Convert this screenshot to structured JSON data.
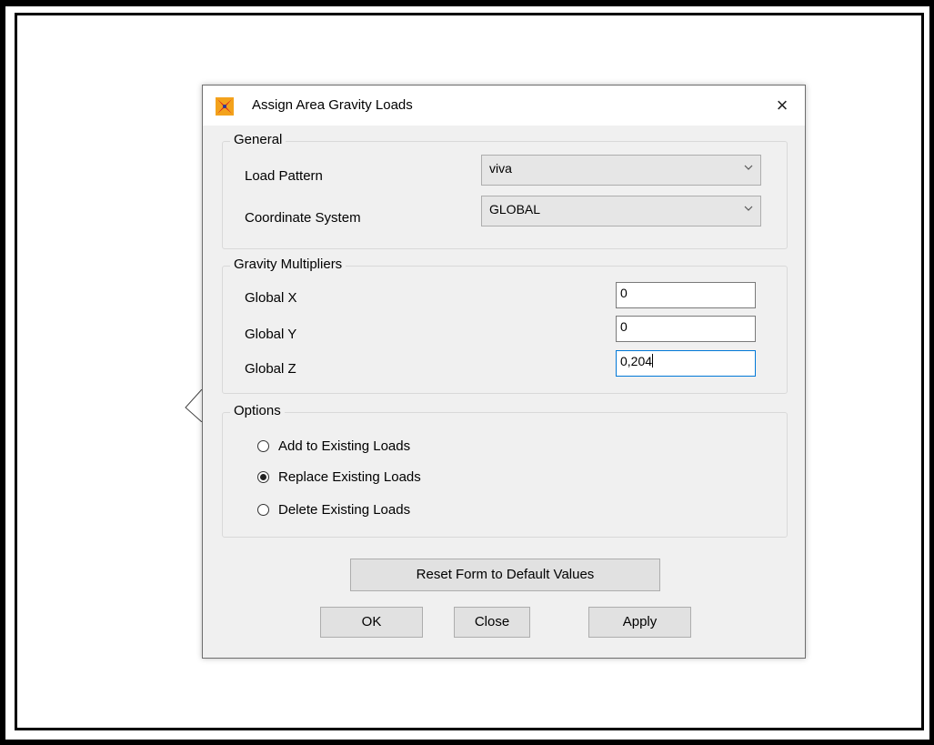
{
  "dialog": {
    "title": "Assign Area Gravity Loads",
    "close_glyph": "×"
  },
  "general": {
    "title": "General",
    "load_pattern_label": "Load Pattern",
    "load_pattern_value": "viva",
    "coord_system_label": "Coordinate System",
    "coord_system_value": "GLOBAL"
  },
  "gravity": {
    "title": "Gravity Multipliers",
    "x_label": "Global X",
    "x_value": "0",
    "y_label": "Global Y",
    "y_value": "0",
    "z_label": "Global Z",
    "z_value": "0,204"
  },
  "options": {
    "title": "Options",
    "items": [
      {
        "label": "Add to Existing Loads",
        "checked": false
      },
      {
        "label": "Replace Existing Loads",
        "checked": true
      },
      {
        "label": "Delete Existing Loads",
        "checked": false
      }
    ]
  },
  "buttons": {
    "reset": "Reset Form to Default Values",
    "ok": "OK",
    "close": "Close",
    "apply": "Apply"
  },
  "icons": {
    "app": "sap2000-app-icon",
    "dropdown": "chevron-down-icon",
    "close": "close-icon"
  }
}
